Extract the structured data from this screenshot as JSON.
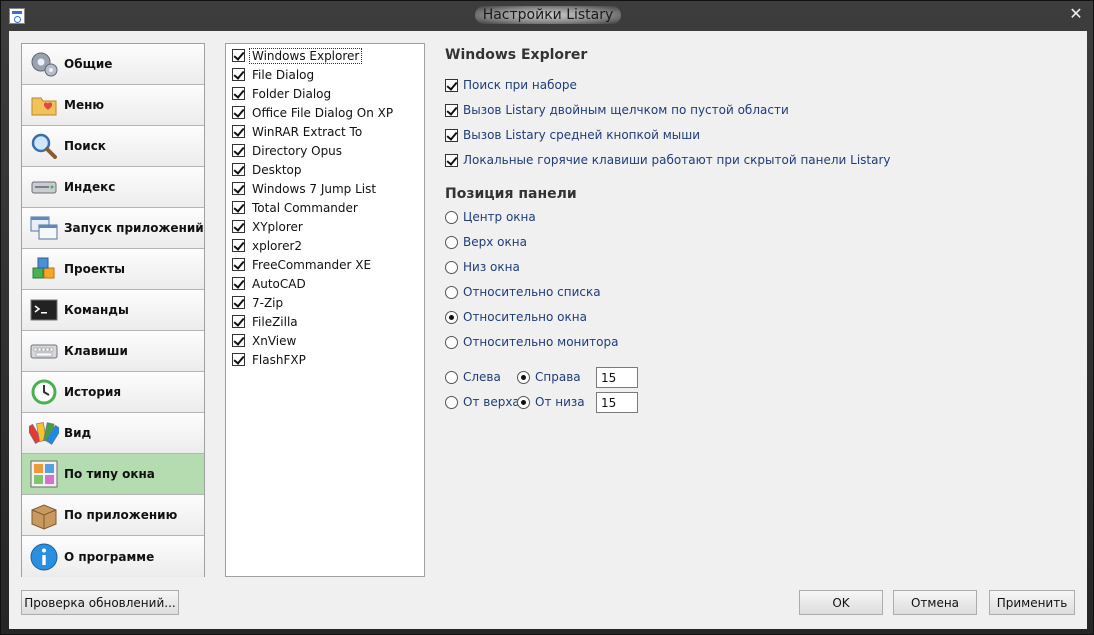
{
  "window": {
    "title": "Настройки Listary",
    "close_glyph": "✕"
  },
  "sidebar": {
    "items": [
      {
        "label": "Общие",
        "icon": "gears-icon"
      },
      {
        "label": "Меню",
        "icon": "folder-heart-icon"
      },
      {
        "label": "Поиск",
        "icon": "magnifier-icon"
      },
      {
        "label": "Индекс",
        "icon": "drive-icon"
      },
      {
        "label": "Запуск приложений",
        "icon": "windows-icon"
      },
      {
        "label": "Проекты",
        "icon": "cubes-icon"
      },
      {
        "label": "Команды",
        "icon": "terminal-icon"
      },
      {
        "label": "Клавиши",
        "icon": "keyboard-icon"
      },
      {
        "label": "История",
        "icon": "clock-history-icon"
      },
      {
        "label": "Вид",
        "icon": "palette-icon"
      },
      {
        "label": "По типу окна",
        "icon": "window-layout-icon",
        "selected": true
      },
      {
        "label": "По приложению",
        "icon": "box-icon"
      },
      {
        "label": "О программе",
        "icon": "info-icon"
      }
    ]
  },
  "apps_list": {
    "items": [
      {
        "label": "Windows Explorer",
        "checked": true
      },
      {
        "label": "File Dialog",
        "checked": true
      },
      {
        "label": "Folder Dialog",
        "checked": true
      },
      {
        "label": "Office File Dialog On XP",
        "checked": true
      },
      {
        "label": "WinRAR Extract To",
        "checked": true
      },
      {
        "label": "Directory Opus",
        "checked": true
      },
      {
        "label": "Desktop",
        "checked": true
      },
      {
        "label": "Windows 7 Jump List",
        "checked": true
      },
      {
        "label": "Total Commander",
        "checked": true
      },
      {
        "label": "XYplorer",
        "checked": true
      },
      {
        "label": "xplorer2",
        "checked": true
      },
      {
        "label": "FreeCommander XE",
        "checked": true
      },
      {
        "label": "AutoCAD",
        "checked": true
      },
      {
        "label": "7-Zip",
        "checked": true
      },
      {
        "label": "FileZilla",
        "checked": true
      },
      {
        "label": "XnView",
        "checked": true
      },
      {
        "label": "FlashFXP",
        "checked": true
      }
    ]
  },
  "settings": {
    "title": "Windows Explorer",
    "options": [
      {
        "label": "Поиск при наборе",
        "checked": true
      },
      {
        "label": "Вызов Listary двойным щелчком по пустой области",
        "checked": true
      },
      {
        "label": "Вызов Listary средней кнопкой мыши",
        "checked": true
      },
      {
        "label": "Локальные горячие клавиши работают при скрытой панели Listary",
        "checked": true
      }
    ],
    "position_title": "Позиция панели",
    "positions": [
      {
        "label": "Центр окна",
        "selected": false
      },
      {
        "label": "Верх окна",
        "selected": false
      },
      {
        "label": "Низ окна",
        "selected": false
      },
      {
        "label": "Относительно списка",
        "selected": false
      },
      {
        "label": "Относительно окна",
        "selected": true
      },
      {
        "label": "Относительно монитора",
        "selected": false
      }
    ],
    "horizontal": {
      "left_label": "Слева",
      "right_label": "Справа",
      "selected": "right",
      "value": "15"
    },
    "vertical": {
      "top_label": "От верха",
      "bottom_label": "От низа",
      "selected": "bottom",
      "value": "15"
    }
  },
  "buttons": {
    "check_updates": "Проверка обновлений...",
    "ok": "OK",
    "cancel": "Отмена",
    "apply": "Применить"
  },
  "colors": {
    "selected_nav": "#b5dbb0",
    "option_text": "#1f3c7a"
  }
}
